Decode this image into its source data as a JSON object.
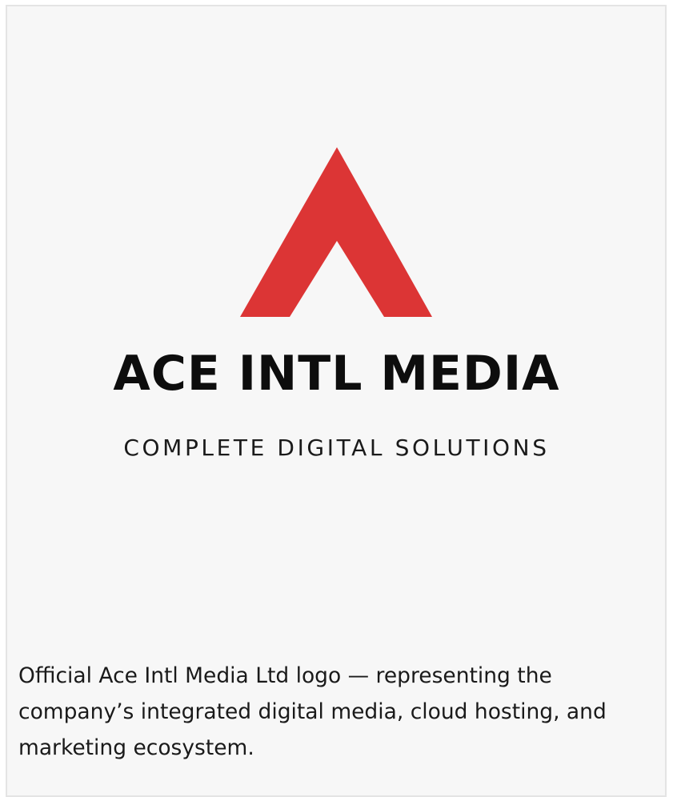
{
  "logo": {
    "icon": "red-chevron-a-mark",
    "mark_color": "#dc3535",
    "name": "ACE INTL MEDIA",
    "tagline": "COMPLETE DIGITAL SOLUTIONS"
  },
  "caption": "Official Ace Intl Media Ltd logo — representing the company’s integrated digital media, cloud hosting, and marketing ecosystem."
}
